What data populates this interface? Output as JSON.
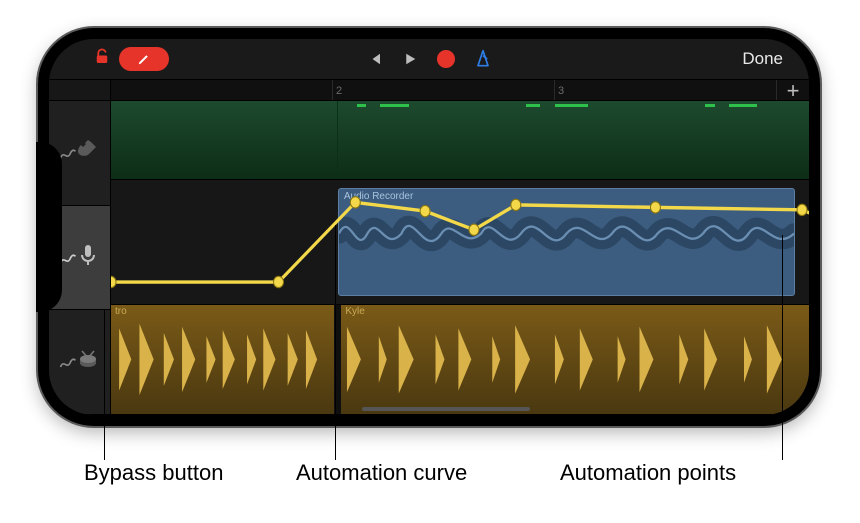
{
  "colors": {
    "accent_red": "#e6342b",
    "accent_blue": "#2d7fea",
    "automation_yellow": "#f3d94a"
  },
  "toolbar": {
    "done_label": "Done"
  },
  "ruler": {
    "ticks": [
      "2",
      "3"
    ],
    "add_label": "+"
  },
  "tracks": {
    "green": {},
    "audio": {
      "region_title": "Audio Recorder"
    },
    "drums": {
      "region_a_title": "tro",
      "region_b_title": "Kyle"
    }
  },
  "automation": {
    "points": [
      {
        "x": 0,
        "y": 0.82
      },
      {
        "x": 0.24,
        "y": 0.82
      },
      {
        "x": 0.35,
        "y": 0.18
      },
      {
        "x": 0.45,
        "y": 0.25
      },
      {
        "x": 0.52,
        "y": 0.4
      },
      {
        "x": 0.58,
        "y": 0.2
      },
      {
        "x": 0.78,
        "y": 0.22
      },
      {
        "x": 0.99,
        "y": 0.24
      },
      {
        "x": 1.03,
        "y": 0.33
      }
    ]
  },
  "callouts": {
    "bypass": "Bypass button",
    "curve": "Automation curve",
    "points": "Automation points"
  }
}
